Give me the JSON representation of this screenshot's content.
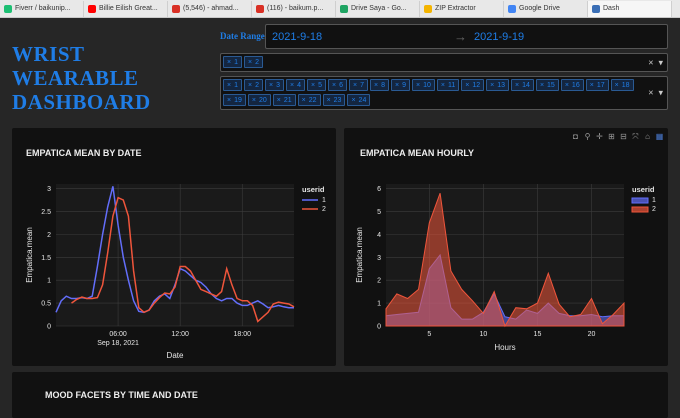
{
  "browser": {
    "tabs": [
      {
        "label": "Fiverr / baikunip...",
        "color": "#1dbf73"
      },
      {
        "label": "Billie Eilish Great...",
        "color": "#ff0000"
      },
      {
        "label": "(5,546) - ahmad...",
        "color": "#d93025"
      },
      {
        "label": "(116) - baikum.p...",
        "color": "#d93025"
      },
      {
        "label": "Drive Saya - Go...",
        "color": "#1fa463"
      },
      {
        "label": "ZIP Extractor",
        "color": "#f4b400"
      },
      {
        "label": "Google Drive",
        "color": "#4285f4"
      },
      {
        "label": "Dash",
        "color": "#3b6fb6"
      }
    ]
  },
  "header": {
    "title_line1": "WRIST",
    "title_line2": "WEARABLE",
    "title_line3": "DASHBOARD"
  },
  "date_range": {
    "label": "Date Range",
    "start": "2021-9-18",
    "arrow": "→",
    "end": "2021-9-19"
  },
  "user_dropdown": {
    "selected": [
      "1",
      "2"
    ]
  },
  "hour_dropdown": {
    "selected": [
      "1",
      "2",
      "3",
      "4",
      "5",
      "6",
      "7",
      "8",
      "9",
      "10",
      "11",
      "12",
      "13",
      "14",
      "15",
      "16",
      "17",
      "18",
      "19",
      "20",
      "21",
      "22",
      "23",
      "24"
    ]
  },
  "dropdown_controls": {
    "clear": "×",
    "open": "▾"
  },
  "colors": {
    "accent": "#1f7de6",
    "series1": "#636efa",
    "series2": "#ef553b"
  },
  "modebar_icons": [
    "camera-icon",
    "zoom-icon",
    "pan-icon",
    "zoom-in-icon",
    "zoom-out-icon",
    "autoscale-icon",
    "home-icon",
    "plotly-logo-icon"
  ],
  "mood": {
    "title": "MOOD FACETS BY TIME AND DATE"
  },
  "chart_data": [
    {
      "type": "line",
      "title": "EMPATICA MEAN BY DATE",
      "xlabel": "Date",
      "ylabel": "Empatica.mean",
      "x_tick_labels": [
        "06:00",
        "12:00",
        "18:00"
      ],
      "x_tick_values": [
        6,
        12,
        18
      ],
      "x_date_label": "Sep 18, 2021",
      "xlim": [
        0,
        23
      ],
      "ylim": [
        0,
        3.1
      ],
      "y_ticks": [
        0,
        0.5,
        1,
        1.5,
        2,
        2.5,
        3
      ],
      "legend_title": "userid",
      "legend_position": "top-right",
      "series": [
        {
          "name": "1",
          "color": "#636efa",
          "x": [
            0,
            0.5,
            1,
            1.5,
            2,
            2.5,
            3,
            3.5,
            4,
            4.5,
            5,
            5.5,
            6,
            6.5,
            7,
            7.5,
            8,
            8.5,
            9,
            9.5,
            10,
            10.5,
            11,
            11.5,
            12,
            12.5,
            13,
            13.5,
            14,
            14.5,
            15,
            15.5,
            16,
            16.5,
            17,
            17.5,
            18,
            18.5,
            19,
            19.5,
            20,
            20.5,
            21,
            21.5,
            22,
            22.5,
            23
          ],
          "y": [
            0.3,
            0.55,
            0.65,
            0.6,
            0.6,
            0.62,
            0.6,
            0.65,
            1.3,
            2.0,
            2.6,
            3.05,
            2.2,
            1.5,
            1.0,
            0.55,
            0.32,
            0.3,
            0.35,
            0.55,
            0.65,
            0.7,
            0.6,
            0.9,
            1.25,
            1.2,
            1.1,
            1.0,
            0.95,
            0.85,
            0.7,
            0.6,
            0.55,
            0.6,
            0.6,
            0.5,
            0.45,
            0.45,
            0.5,
            0.55,
            0.48,
            0.4,
            0.42,
            0.45,
            0.42,
            0.4,
            0.4
          ]
        },
        {
          "name": "2",
          "color": "#ef553b",
          "x": [
            1.5,
            2,
            2.5,
            3,
            3.5,
            4,
            4.5,
            5,
            5.5,
            6,
            6.5,
            7,
            7.5,
            8,
            8.5,
            9,
            9.5,
            10,
            10.5,
            11,
            11.5,
            12,
            12.5,
            13,
            13.5,
            14,
            14.5,
            15,
            15.5,
            16,
            16.5,
            17,
            17.5,
            18,
            18.5,
            19,
            19.5,
            20,
            20.5,
            21,
            21.5,
            22,
            22.5,
            23
          ],
          "y": [
            0.5,
            0.58,
            0.63,
            0.6,
            0.6,
            0.62,
            0.9,
            1.6,
            2.4,
            2.8,
            2.75,
            2.4,
            1.2,
            0.4,
            0.3,
            0.35,
            0.5,
            0.62,
            0.72,
            0.7,
            0.85,
            1.3,
            1.3,
            1.2,
            1.0,
            0.8,
            0.75,
            0.7,
            0.65,
            0.75,
            1.25,
            0.9,
            0.6,
            0.55,
            0.55,
            0.45,
            0.1,
            0.2,
            0.3,
            0.48,
            0.52,
            0.5,
            0.48,
            0.42
          ]
        }
      ]
    },
    {
      "type": "area",
      "title": "EMPATICA MEAN HOURLY",
      "xlabel": "Hours",
      "ylabel": "Empatica.mean",
      "x_ticks": [
        5,
        10,
        15,
        20
      ],
      "xlim": [
        1,
        23
      ],
      "ylim": [
        0,
        6.2
      ],
      "y_ticks": [
        0,
        1,
        2,
        3,
        4,
        5,
        6
      ],
      "legend_title": "userid",
      "legend_position": "top-right",
      "series": [
        {
          "name": "1",
          "color": "#636efa",
          "x": [
            1,
            2,
            3,
            4,
            5,
            6,
            7,
            8,
            9,
            10,
            11,
            12,
            13,
            14,
            15,
            16,
            17,
            18,
            19,
            20,
            21,
            22,
            23
          ],
          "y": [
            0.45,
            0.5,
            0.55,
            0.6,
            2.5,
            3.1,
            0.8,
            0.3,
            0.3,
            0.6,
            1.4,
            0.4,
            0.3,
            0.7,
            0.55,
            1.0,
            0.55,
            0.45,
            0.45,
            0.5,
            0.4,
            0.45,
            0.45
          ]
        },
        {
          "name": "2",
          "color": "#ef553b",
          "x": [
            1,
            2,
            3,
            4,
            5,
            6,
            7,
            8,
            9,
            10,
            11,
            12,
            13,
            14,
            15,
            16,
            17,
            18,
            19,
            20,
            21,
            22,
            23
          ],
          "y": [
            0.75,
            1.4,
            1.2,
            1.6,
            4.5,
            5.8,
            2.4,
            1.6,
            1.1,
            0.55,
            1.5,
            0.0,
            0.8,
            0.75,
            1.0,
            2.3,
            0.95,
            0.4,
            0.5,
            1.2,
            0.1,
            0.5,
            1.0
          ]
        }
      ]
    }
  ]
}
